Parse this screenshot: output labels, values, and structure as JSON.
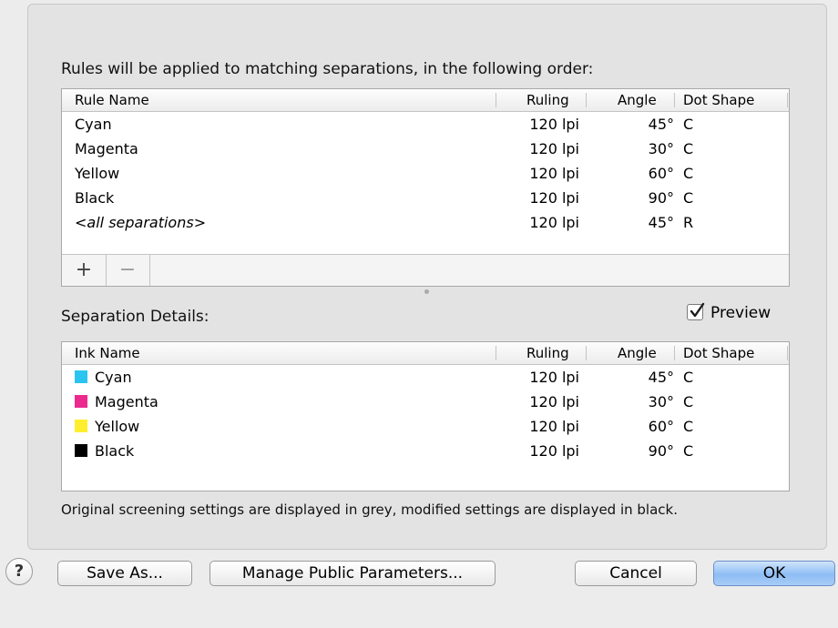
{
  "rules": {
    "heading": "Rules will be applied to matching separations, in the following order:",
    "columns": {
      "name": "Rule Name",
      "ruling": "Ruling",
      "angle": "Angle",
      "dot": "Dot Shape"
    },
    "rows": [
      {
        "name": "Cyan",
        "ruling": "120 lpi",
        "angle": "45°",
        "dot": "C"
      },
      {
        "name": "Magenta",
        "ruling": "120 lpi",
        "angle": "30°",
        "dot": "C"
      },
      {
        "name": "Yellow",
        "ruling": "120 lpi",
        "angle": "60°",
        "dot": "C"
      },
      {
        "name": "Black",
        "ruling": "120 lpi",
        "angle": "90°",
        "dot": "C"
      },
      {
        "name": "<all separations>",
        "ruling": "120 lpi",
        "angle": "45°",
        "dot": "R"
      }
    ],
    "add_label": "+",
    "remove_label": "−"
  },
  "details": {
    "heading": "Separation Details:",
    "preview_label": "Preview",
    "preview_checked": true,
    "columns": {
      "name": "Ink Name",
      "ruling": "Ruling",
      "angle": "Angle",
      "dot": "Dot Shape"
    },
    "rows": [
      {
        "name": "Cyan",
        "color": "#29c4f0",
        "ruling": "120 lpi",
        "angle": "45°",
        "dot": "C"
      },
      {
        "name": "Magenta",
        "color": "#ec2a8e",
        "ruling": "120 lpi",
        "angle": "30°",
        "dot": "C"
      },
      {
        "name": "Yellow",
        "color": "#ffee2e",
        "ruling": "120 lpi",
        "angle": "60°",
        "dot": "C"
      },
      {
        "name": "Black",
        "color": "#000000",
        "ruling": "120 lpi",
        "angle": "90°",
        "dot": "C"
      }
    ]
  },
  "note": "Original screening settings are displayed in grey, modified settings are displayed in black.",
  "buttons": {
    "help": "?",
    "save_as": "Save As...",
    "manage": "Manage Public Parameters...",
    "cancel": "Cancel",
    "ok": "OK"
  }
}
